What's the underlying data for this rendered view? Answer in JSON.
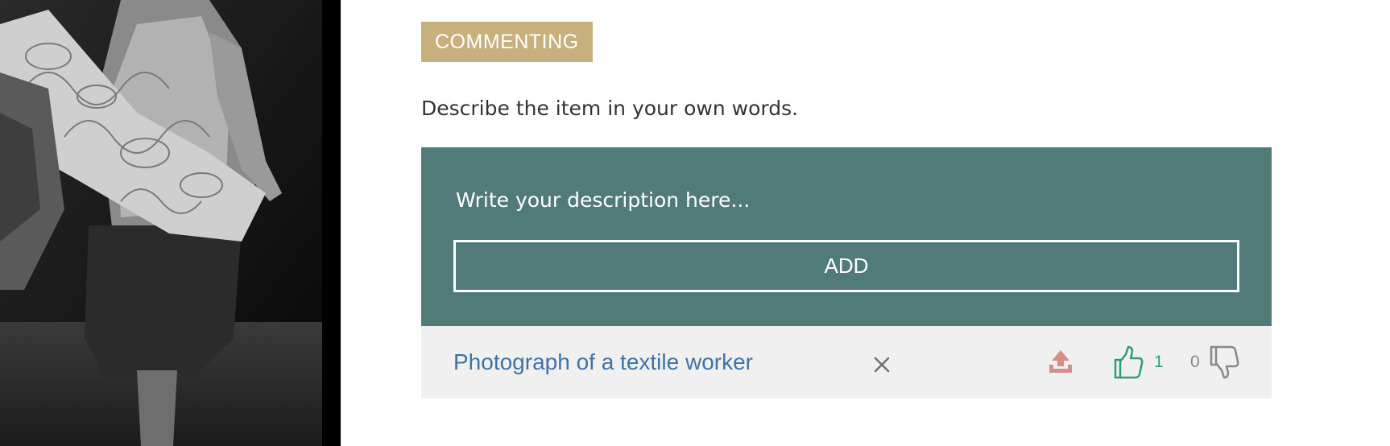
{
  "task": {
    "badge_label": "COMMENTING",
    "instructions": "Describe the item in your own words."
  },
  "editor": {
    "placeholder": "Write your description here...",
    "value": "",
    "add_label": "ADD"
  },
  "comments": [
    {
      "text": "Photograph of a textile worker",
      "upvotes": "1",
      "downvotes": "0"
    }
  ],
  "icons": {
    "share": "share-upload-icon",
    "upvote": "thumbs-up-icon",
    "downvote": "thumbs-down-icon",
    "close": "close-icon"
  },
  "colors": {
    "badge": "#c8b07e",
    "editor_background": "#517b78",
    "link": "#3c74a8",
    "upvote": "#2f9d74",
    "share": "#d48f86"
  }
}
